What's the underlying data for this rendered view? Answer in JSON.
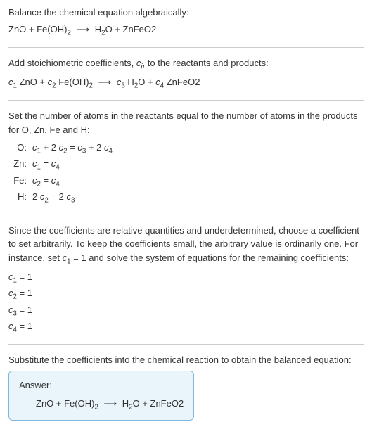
{
  "title": "Balance the chemical equation algebraically:",
  "main_eq": "ZnO + Fe(OH)<sub>2</sub> <span class='arrow'>⟶</span> H<sub>2</sub>O + ZnFeO2",
  "step1": "Add stoichiometric coefficients, <span class='ital'>c<sub>i</sub></span>, to the reactants and products:",
  "step1_eq": "<span class='ital'>c</span><sub>1</sub> ZnO + <span class='ital'>c</span><sub>2</sub> Fe(OH)<sub>2</sub> <span class='arrow'>⟶</span> <span class='ital'>c</span><sub>3</sub> H<sub>2</sub>O + <span class='ital'>c</span><sub>4</sub> ZnFeO2",
  "step2": "Set the number of atoms in the reactants equal to the number of atoms in the products for O, Zn, Fe and H:",
  "atom_balance": [
    {
      "label": "O:",
      "eq": "<span class='ital'>c</span><sub>1</sub> + 2 <span class='ital'>c</span><sub>2</sub> = <span class='ital'>c</span><sub>3</sub> + 2 <span class='ital'>c</span><sub>4</sub>"
    },
    {
      "label": "Zn:",
      "eq": "<span class='ital'>c</span><sub>1</sub> = <span class='ital'>c</span><sub>4</sub>"
    },
    {
      "label": "Fe:",
      "eq": "<span class='ital'>c</span><sub>2</sub> = <span class='ital'>c</span><sub>4</sub>"
    },
    {
      "label": "H:",
      "eq": "2 <span class='ital'>c</span><sub>2</sub> = 2 <span class='ital'>c</span><sub>3</sub>"
    }
  ],
  "step3": "Since the coefficients are relative quantities and underdetermined, choose a coefficient to set arbitrarily. To keep the coefficients small, the arbitrary value is ordinarily one. For instance, set <span class='ital'>c</span><sub>1</sub> = 1 and solve the system of equations for the remaining coefficients:",
  "solutions": [
    "<span class='ital'>c</span><sub>1</sub> = 1",
    "<span class='ital'>c</span><sub>2</sub> = 1",
    "<span class='ital'>c</span><sub>3</sub> = 1",
    "<span class='ital'>c</span><sub>4</sub> = 1"
  ],
  "step4": "Substitute the coefficients into the chemical reaction to obtain the balanced equation:",
  "answer_label": "Answer:",
  "answer_eq": "ZnO + Fe(OH)<sub>2</sub> <span class='arrow'>⟶</span> H<sub>2</sub>O + ZnFeO2"
}
